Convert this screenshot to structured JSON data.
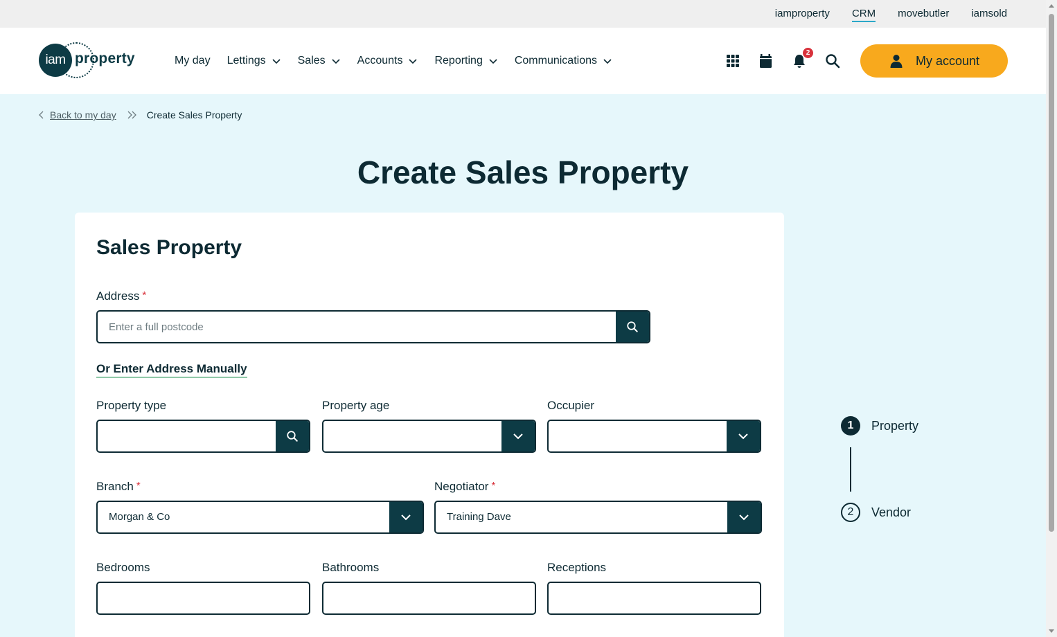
{
  "topbar": {
    "links": [
      "iamproperty",
      "CRM",
      "movebutler",
      "iamsold"
    ],
    "active": "CRM"
  },
  "logo": {
    "mark": "iam",
    "word": "property"
  },
  "nav": {
    "items": [
      {
        "label": "My day",
        "dropdown": false
      },
      {
        "label": "Lettings",
        "dropdown": true
      },
      {
        "label": "Sales",
        "dropdown": true
      },
      {
        "label": "Accounts",
        "dropdown": true
      },
      {
        "label": "Reporting",
        "dropdown": true
      },
      {
        "label": "Communications",
        "dropdown": true
      }
    ]
  },
  "tools": {
    "notifications_count": "2",
    "icons": [
      "apps-grid-icon",
      "calendar-icon",
      "bell-icon",
      "search-icon"
    ]
  },
  "account": {
    "label": "My account"
  },
  "breadcrumb": {
    "back": "Back to my day",
    "current": "Create Sales Property"
  },
  "page": {
    "title": "Create Sales Property"
  },
  "form": {
    "section_title": "Sales Property",
    "address": {
      "label": "Address",
      "placeholder": "Enter a full postcode",
      "required": true
    },
    "manual_link": "Or Enter Address Manually",
    "property_type": {
      "label": "Property type",
      "value": ""
    },
    "property_age": {
      "label": "Property age",
      "value": ""
    },
    "occupier": {
      "label": "Occupier",
      "value": ""
    },
    "branch": {
      "label": "Branch",
      "value": "Morgan & Co",
      "required": true
    },
    "negotiator": {
      "label": "Negotiator",
      "value": "Training Dave",
      "required": true
    },
    "bedrooms": {
      "label": "Bedrooms",
      "value": ""
    },
    "bathrooms": {
      "label": "Bathrooms",
      "value": ""
    },
    "receptions": {
      "label": "Receptions",
      "value": ""
    }
  },
  "stepper": {
    "steps": [
      {
        "number": "1",
        "label": "Property",
        "state": "active"
      },
      {
        "number": "2",
        "label": "Vendor",
        "state": "todo"
      }
    ]
  },
  "colors": {
    "primary": "#0d3b45",
    "accent": "#f8a91d",
    "page_bg": "#e6f7fb",
    "required": "#d8323c"
  }
}
